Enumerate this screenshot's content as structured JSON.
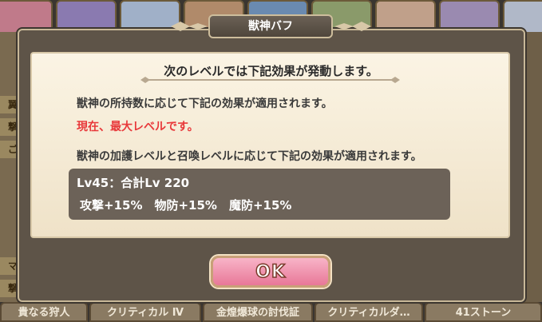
{
  "dialog": {
    "title": "獣神バフ",
    "headline": "次のレベルでは下記効果が発動します。",
    "line_possession": "獣神の所持数に応じて下記の効果が適用されます。",
    "line_max": "現在、最大レベルです。",
    "line_protection": "獣神の加護レベルと召喚レベルに応じて下記の効果が適用されます。",
    "level_line": "Lv45：合計Lv 220",
    "buffs_line": "攻撃+15%　物防+15%　魔防+15%",
    "ok_label": "OK"
  },
  "background": {
    "bottom_tabs": [
      "貴なる狩人",
      "クリティカル Ⅳ",
      "金煌爆球の討伐証",
      "クリティカルダ…",
      "41ストーン"
    ],
    "left_tags": [
      "翼",
      "撃",
      "ご",
      "マ",
      "撃"
    ]
  },
  "colors": {
    "dialog_frame": "#5e5448",
    "panel_bg": "#fbf4e4",
    "max_text": "#e8383a",
    "ok_button": "#f0a0b8"
  }
}
